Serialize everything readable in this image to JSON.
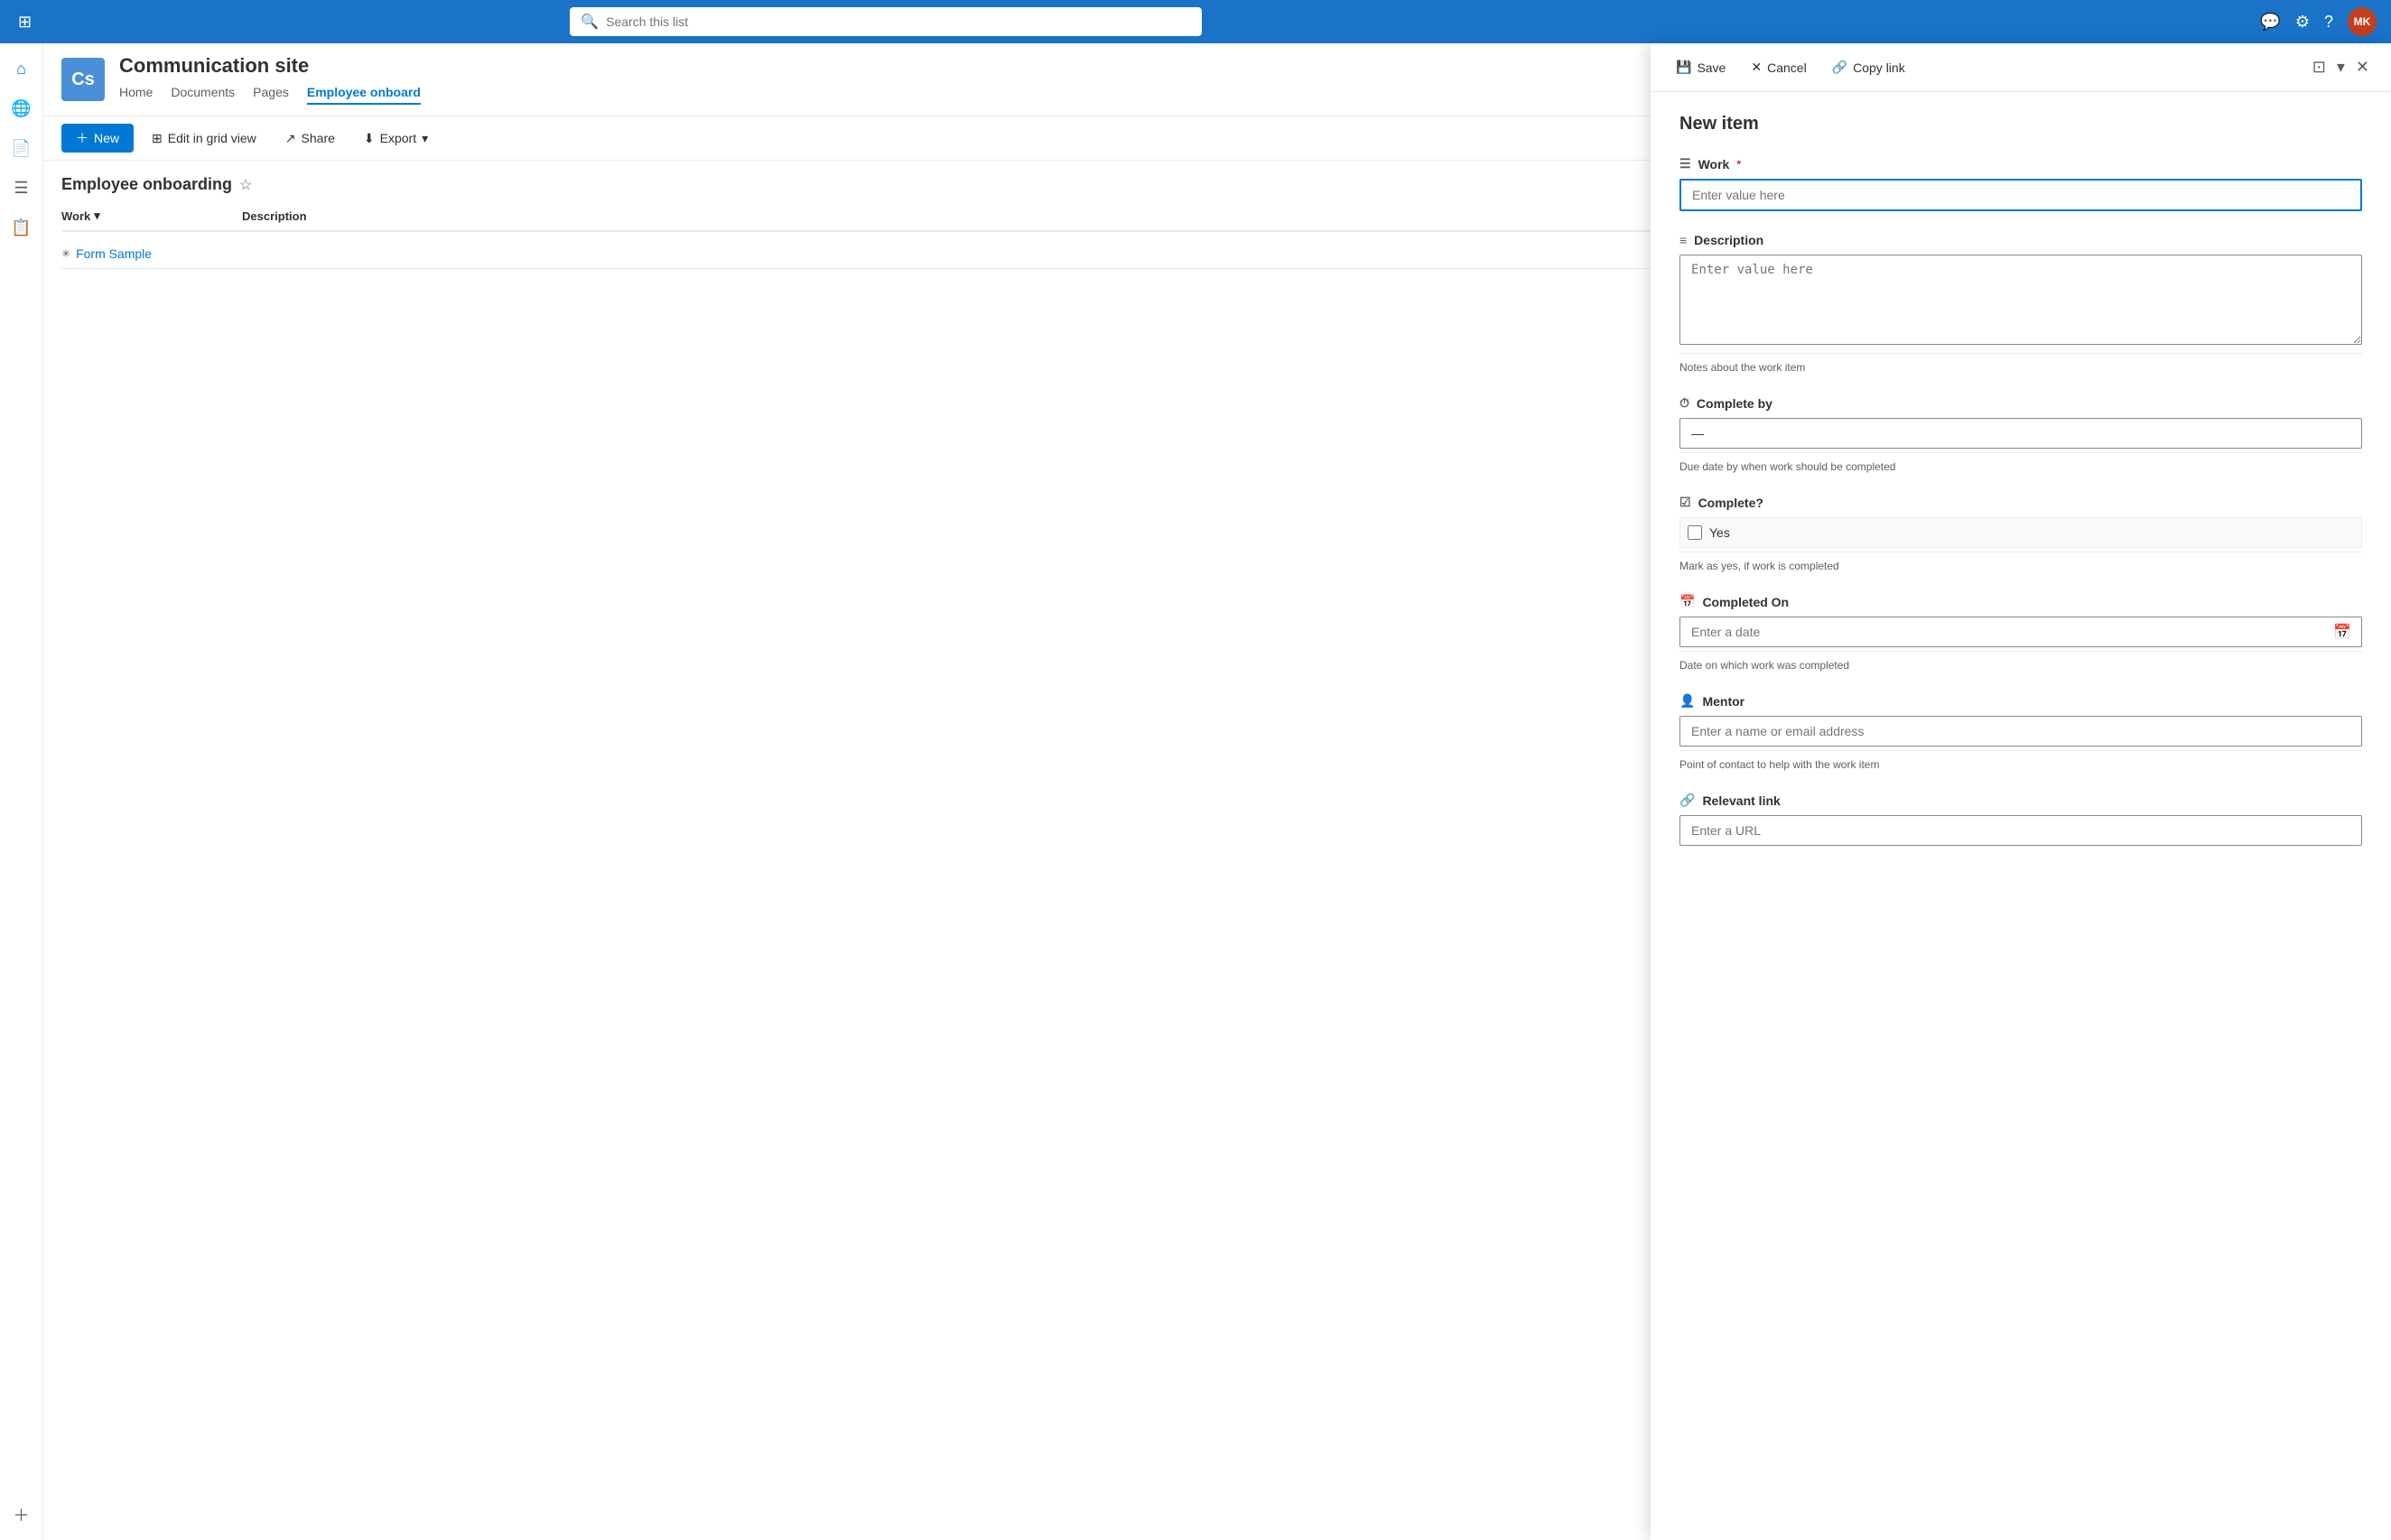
{
  "topNav": {
    "search_placeholder": "Search this list",
    "waffle_icon": "⊞",
    "avatar_initials": "MK",
    "avatar_bg": "#c43e1c"
  },
  "sidebar": {
    "items": [
      {
        "icon": "⌂",
        "label": "Home"
      },
      {
        "icon": "🌐",
        "label": "Sites"
      },
      {
        "icon": "📄",
        "label": "Pages"
      },
      {
        "icon": "☰",
        "label": "Lists"
      },
      {
        "icon": "📋",
        "label": "Library"
      },
      {
        "icon": "＋",
        "label": "Add"
      }
    ]
  },
  "site": {
    "logo": "Cs",
    "name": "Communication site",
    "nav": [
      {
        "label": "Home",
        "active": false
      },
      {
        "label": "Documents",
        "active": false
      },
      {
        "label": "Pages",
        "active": false
      },
      {
        "label": "Employee onboard",
        "active": true
      }
    ]
  },
  "toolbar": {
    "new_label": "New",
    "edit_grid_label": "Edit in grid view",
    "share_label": "Share",
    "export_label": "Export"
  },
  "list": {
    "title": "Employee onboarding",
    "columns": [
      {
        "label": "Work"
      },
      {
        "label": "Description"
      }
    ],
    "rows": [
      {
        "title": "Form Sample",
        "description": ""
      }
    ]
  },
  "panel": {
    "save_label": "Save",
    "cancel_label": "Cancel",
    "copy_link_label": "Copy link",
    "title": "New item",
    "fields": {
      "work": {
        "label": "Work",
        "required": true,
        "placeholder": "Enter value here",
        "icon": "list-icon"
      },
      "description": {
        "label": "Description",
        "placeholder": "Enter value here",
        "hint": "Notes about the work item",
        "icon": "text-icon"
      },
      "complete_by": {
        "label": "Complete by",
        "placeholder": "—",
        "hint": "Due date by when work should be completed",
        "icon": "clock-icon"
      },
      "complete": {
        "label": "Complete?",
        "checkbox_label": "Yes",
        "hint": "Mark as yes, if work is completed",
        "icon": "checkbox-icon"
      },
      "completed_on": {
        "label": "Completed On",
        "placeholder": "Enter a date",
        "hint": "Date on which work was completed",
        "icon": "calendar-icon"
      },
      "mentor": {
        "label": "Mentor",
        "placeholder": "Enter a name or email address",
        "hint": "Point of contact to help with the work item",
        "icon": "person-icon"
      },
      "relevant_link": {
        "label": "Relevant link",
        "placeholder": "Enter a URL",
        "icon": "link-icon"
      }
    }
  }
}
